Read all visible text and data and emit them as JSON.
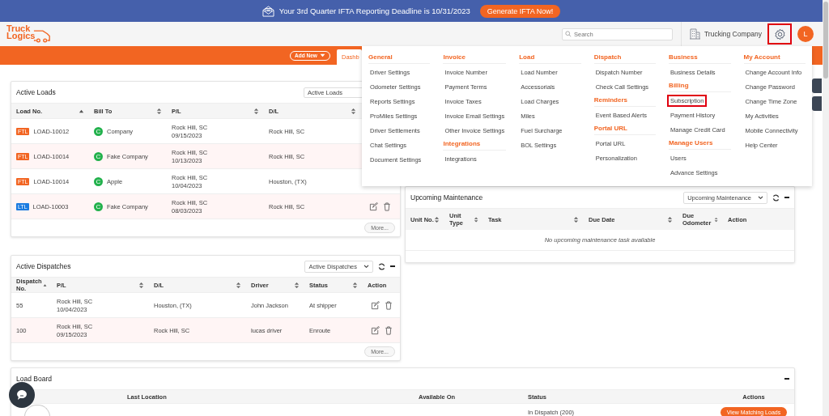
{
  "banner": {
    "message": "Your 3rd Quarter IFTA Reporting Deadline is 10/31/2023",
    "button": "Generate IFTA Now!"
  },
  "header": {
    "logo": {
      "line1": "Truck",
      "line2": "Logics"
    },
    "search": {
      "placeholder": "Search"
    },
    "company": "Trucking Company",
    "settings_highlighted": true,
    "avatar": "L"
  },
  "nav": {
    "add_new": "Add New",
    "tabs": [
      {
        "label": "Dashb",
        "selected": true
      }
    ]
  },
  "settings_menu": {
    "columns": [
      {
        "sections": [
          {
            "title": "General",
            "items": [
              {
                "label": "Driver Settings",
                "highlighted": false
              },
              {
                "label": "Odometer Settings",
                "highlighted": false
              },
              {
                "label": "Reports Settings",
                "highlighted": false
              },
              {
                "label": "ProMiles Settings",
                "highlighted": false
              },
              {
                "label": "Driver Settlements",
                "highlighted": false
              },
              {
                "label": "Chat Settings",
                "highlighted": false
              },
              {
                "label": "Document Settings",
                "highlighted": false
              }
            ]
          }
        ]
      },
      {
        "sections": [
          {
            "title": "Invoice",
            "items": [
              {
                "label": "Invoice Number",
                "highlighted": false
              },
              {
                "label": "Payment Terms",
                "highlighted": false
              },
              {
                "label": "Invoice Taxes",
                "highlighted": false
              },
              {
                "label": "Invoice Email Settings",
                "highlighted": false
              },
              {
                "label": "Other Invoice Settings",
                "highlighted": false
              }
            ]
          },
          {
            "title": "Integrations",
            "items": [
              {
                "label": "Integrations",
                "highlighted": false
              }
            ]
          }
        ]
      },
      {
        "sections": [
          {
            "title": "Load",
            "items": [
              {
                "label": "Load Number",
                "highlighted": false
              },
              {
                "label": "Accessorials",
                "highlighted": false
              },
              {
                "label": "Load Charges",
                "highlighted": false
              },
              {
                "label": "Miles",
                "highlighted": false
              },
              {
                "label": "Fuel Surcharge",
                "highlighted": false
              },
              {
                "label": "BOL Settings",
                "highlighted": false
              }
            ]
          }
        ]
      },
      {
        "sections": [
          {
            "title": "Dispatch",
            "items": [
              {
                "label": "Dispatch Number",
                "highlighted": false
              },
              {
                "label": "Check Call Settings",
                "highlighted": false
              }
            ]
          },
          {
            "title": "Reminders",
            "items": [
              {
                "label": "Event Based Alerts",
                "highlighted": false
              }
            ]
          },
          {
            "title": "Portal URL",
            "items": [
              {
                "label": "Portal URL",
                "highlighted": false
              },
              {
                "label": "Personalization",
                "highlighted": false
              }
            ]
          }
        ]
      },
      {
        "sections": [
          {
            "title": "Business",
            "items": [
              {
                "label": "Business Details",
                "highlighted": false
              }
            ]
          },
          {
            "title": "Billing",
            "items": [
              {
                "label": "Subscription",
                "highlighted": true
              },
              {
                "label": "Payment History",
                "highlighted": false
              },
              {
                "label": "Manage Credit Card",
                "highlighted": false
              }
            ]
          },
          {
            "title": "Manage Users",
            "items": [
              {
                "label": "Users",
                "highlighted": false
              },
              {
                "label": "Advance Settings",
                "highlighted": false
              }
            ]
          }
        ]
      },
      {
        "sections": [
          {
            "title": "My Account",
            "items": [
              {
                "label": "Change Account Info",
                "highlighted": false
              },
              {
                "label": "Change Password",
                "highlighted": false
              },
              {
                "label": "Change Time Zone",
                "highlighted": false
              },
              {
                "label": "My Activities",
                "highlighted": false
              },
              {
                "label": "Mobile Connectivity",
                "highlighted": false
              },
              {
                "label": "Help Center",
                "highlighted": false
              }
            ]
          }
        ]
      }
    ]
  },
  "active_loads": {
    "title": "Active Loads",
    "filter": "Active Loads",
    "columns": [
      {
        "label": "Load No.",
        "sorted": true
      },
      {
        "label": "Bill To",
        "sorted": false
      },
      {
        "label": "P/L",
        "sorted": false
      },
      {
        "label": "D/L",
        "sorted": false
      }
    ],
    "rows": [
      {
        "tag": "FTL",
        "color": "#f26522",
        "load_no": "LOAD-10012",
        "badge": "C",
        "bill_to": "Company",
        "pl_city": "Rock Hill, SC",
        "pl_date": "09/15/2023",
        "dl": "Rock Hill, SC"
      },
      {
        "tag": "FTL",
        "color": "#f26522",
        "load_no": "LOAD-10014",
        "badge": "C",
        "bill_to": "Fake Company",
        "pl_city": "Rock Hill, SC",
        "pl_date": "10/13/2023",
        "dl": "Rock Hill, SC"
      },
      {
        "tag": "FTL",
        "color": "#f26522",
        "load_no": "LOAD-10014",
        "badge": "C",
        "bill_to": "Apple",
        "pl_city": "Rock Hill, SC",
        "pl_date": "10/04/2023",
        "dl": "Houston, (TX)"
      },
      {
        "tag": "LTL",
        "color": "#1b7be0",
        "load_no": "LOAD-10003",
        "badge": "C",
        "bill_to": "Fake Company",
        "pl_city": "Rock Hill, SC",
        "pl_date": "08/03/2023",
        "dl": "Rock Hill, SC"
      }
    ],
    "more": "More..."
  },
  "active_dispatches": {
    "title": "Active Dispatches",
    "filter": "Active Dispatches",
    "columns": [
      {
        "label": "Dispatch No.",
        "kind": "sortable",
        "sorted": true
      },
      {
        "label": "P/L",
        "kind": "sortable",
        "sorted": false
      },
      {
        "label": "D/L",
        "kind": "sortable",
        "sorted": false
      },
      {
        "label": "Driver",
        "kind": "sortable",
        "sorted": false
      },
      {
        "label": "Status",
        "kind": "sortable",
        "sorted": false
      },
      {
        "label": "Action",
        "kind": "plain"
      }
    ],
    "rows": [
      {
        "dispatch_no": "55",
        "pl_city": "Rock Hill, SC",
        "pl_date": "10/04/2023",
        "dl": "Houston, (TX)",
        "driver": "John Jackson",
        "status": "At shipper"
      },
      {
        "dispatch_no": "100",
        "pl_city": "Rock Hill, SC",
        "pl_date": "09/15/2023",
        "dl": "Rock Hill, SC",
        "driver": "lucas driver",
        "status": "Enroute"
      }
    ],
    "more": "More..."
  },
  "upcoming_maintenance": {
    "title": "Upcoming Maintenance",
    "filter": "Upcoming Maintenance",
    "columns": [
      {
        "label": "Unit No.",
        "kind": "sortable",
        "sorted": false
      },
      {
        "label": "Unit Type",
        "kind": "sortable",
        "sorted": false
      },
      {
        "label": "Task",
        "kind": "sortable",
        "sorted": false
      },
      {
        "label": "Due Date",
        "kind": "sortable",
        "sorted": false
      },
      {
        "label": "Due Odometer",
        "kind": "sortable",
        "sorted": false
      },
      {
        "label": "Action",
        "kind": "plain"
      }
    ],
    "empty": "No upcoming maintenance task available"
  },
  "load_board": {
    "title": "Load Board",
    "columns": [
      "Last Location",
      "Available On",
      "Status",
      "Actions"
    ],
    "rows": [
      {
        "status": "In Dispatch (200)",
        "button": "View Matching Loads"
      }
    ]
  }
}
